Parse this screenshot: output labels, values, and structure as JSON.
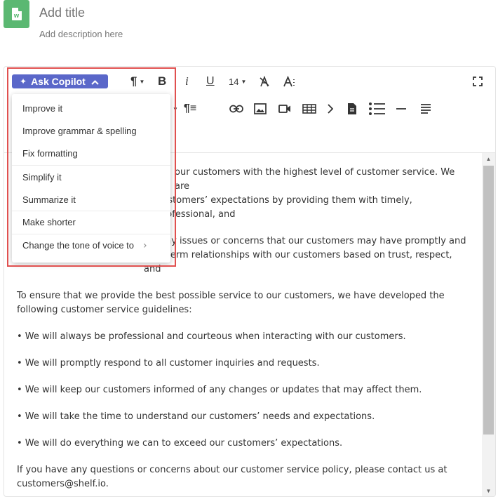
{
  "header": {
    "doc_icon_letter": "W",
    "title_placeholder": "Add title",
    "description_placeholder": "Add description here"
  },
  "toolbar": {
    "copilot_label": "Ask Copilot",
    "font_size": "14"
  },
  "copilot_menu": {
    "items": [
      "Improve it",
      "Improve grammar & spelling",
      "Fix formatting",
      "Simplify it",
      "Summarize it",
      "Make shorter",
      "Change the tone of voice to"
    ]
  },
  "content": {
    "p1": "our customers with the highest level of customer service. We are",
    "p1b": "customers’ expectations by providing them with timely, professional, and",
    "p2": "any issues or concerns that our customers may have promptly and",
    "p2b": "long-term relationships with our customers based on trust, respect, and",
    "p3": "To ensure that we provide the best possible service to our customers, we have developed the following customer service guidelines:",
    "bullets": [
      "• We will always be professional and courteous when interacting with our customers.",
      "• We will promptly respond to all customer inquiries and requests.",
      "• We will keep our customers informed of any changes or updates that may affect them.",
      "• We will take the time to understand our customers’ needs and expectations.",
      "• We will do everything we can to exceed our customers’ expectations."
    ],
    "closing": "If you have any questions or concerns about our customer service policy, please contact us at customers@shelf.io."
  },
  "colors": {
    "copilot_accent": "#5a67c9",
    "doc_icon": "#5bb872",
    "highlight": "#e0504f"
  }
}
